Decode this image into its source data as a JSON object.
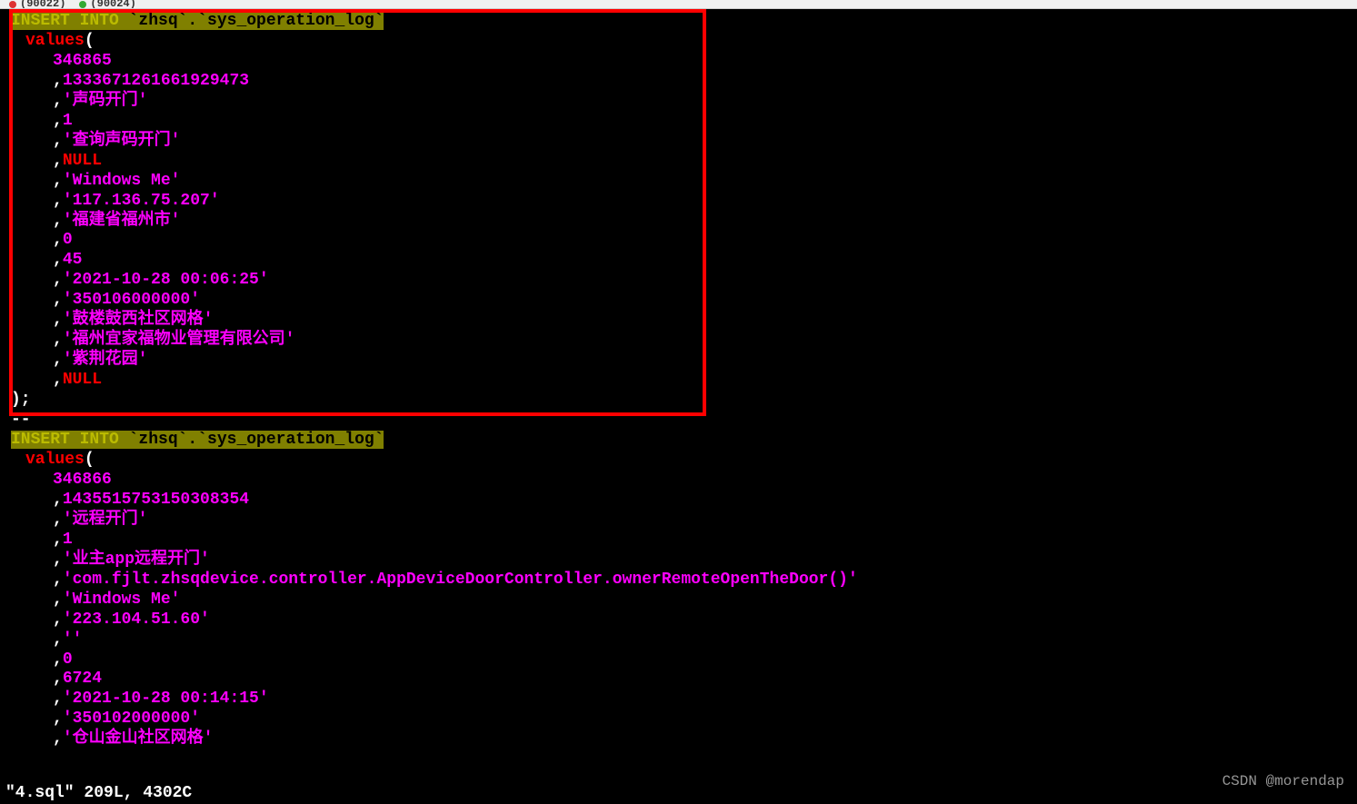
{
  "tabs": {
    "tab1_text": "(90022)",
    "tab2_text": "(90024)"
  },
  "sql1": {
    "insert_into": "INSERT INTO ",
    "table": "`zhsq`.`sys_operation_log`",
    "values_kw": "values",
    "open_paren": "(",
    "close": ");",
    "v_id": "346865",
    "v_num": "1333671261661929473",
    "v_s1": "'声码开门'",
    "v_n1": "1",
    "v_s2": "'查询声码开门'",
    "v_null1": "NULL",
    "v_s3": "'Windows Me'",
    "v_s4": "'117.136.75.207'",
    "v_s5": "'福建省福州市'",
    "v_n2": "0",
    "v_n3": "45",
    "v_s6": "'2021-10-28 00:06:25'",
    "v_s7": "'350106000000'",
    "v_s8": "'鼓楼鼓西社区网格'",
    "v_s9": "'福州宜家福物业管理有限公司'",
    "v_s10": "'紫荆花园'",
    "v_null2": "NULL"
  },
  "sql2": {
    "insert_into": "INSERT INTO ",
    "table": "`zhsq`.`sys_operation_log`",
    "values_kw": "values",
    "open_paren": "(",
    "v_id": "346866",
    "v_num": "1435515753150308354",
    "v_s1": "'远程开门'",
    "v_n1": "1",
    "v_s2": "'业主app远程开门'",
    "v_s3": "'com.fjlt.zhsqdevice.controller.AppDeviceDoorController.ownerRemoteOpenTheDoor()'",
    "v_s4": "'Windows Me'",
    "v_s5": "'223.104.51.60'",
    "v_s6": "''",
    "v_n2": "0",
    "v_n3": "6724",
    "v_s7": "'2021-10-28 00:14:15'",
    "v_s8": "'350102000000'",
    "v_s9": "'仓山金山社区网格'"
  },
  "comma": ",",
  "status": "\"4.sql\" 209L, 4302C",
  "watermark": "CSDN @morendap",
  "cursor": "--"
}
